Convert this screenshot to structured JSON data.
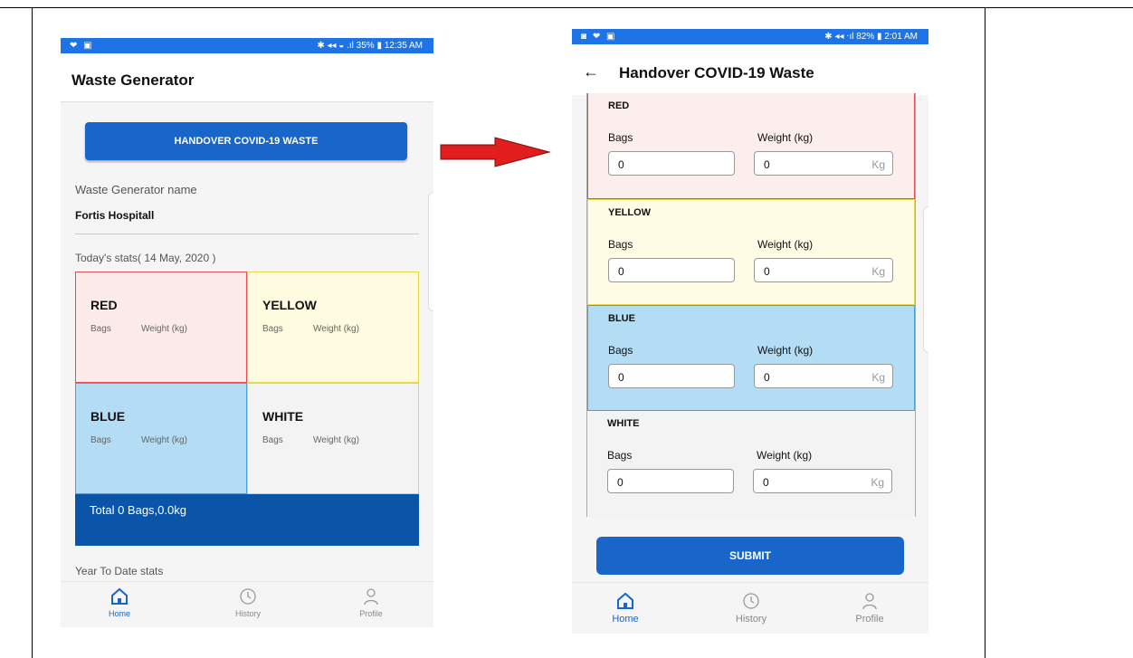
{
  "screen1": {
    "status_left": "❤ ▣",
    "status_right": "✱ ◂◂ ◒ .ıl 35% ▮ 12:35 AM",
    "title": "Waste Generator",
    "handover_button": "HANDOVER COVID-19 WASTE",
    "generator_label": "Waste Generator name",
    "generator_value": "Fortis Hospitall",
    "today_stats": "Today's stats( 14 May, 2020 )",
    "cells": [
      {
        "name": "RED",
        "bags": "Bags",
        "weight": "Weight (kg)"
      },
      {
        "name": "YELLOW",
        "bags": "Bags",
        "weight": "Weight (kg)"
      },
      {
        "name": "BLUE",
        "bags": "Bags",
        "weight": "Weight (kg)"
      },
      {
        "name": "WHITE",
        "bags": "Bags",
        "weight": "Weight (kg)"
      }
    ],
    "total": "Total 0 Bags,0.0kg",
    "ytd": "Year To Date stats",
    "nav": [
      "Home",
      "History",
      "Profile"
    ]
  },
  "screen2": {
    "status_left": "◙ ❤ ▣",
    "status_right": "✱ ◂◂ ‧ıl 82% ▮ 2:01 AM",
    "back": "←",
    "title": "Handover COVID-19 Waste",
    "bags_label": "Bags",
    "weight_label": "Weight (kg)",
    "unit": "Kg",
    "sections": [
      {
        "name": "RED",
        "bags_value": "0",
        "weight_value": "0"
      },
      {
        "name": "YELLOW",
        "bags_value": "0",
        "weight_value": "0"
      },
      {
        "name": "BLUE",
        "bags_value": "0",
        "weight_value": "0"
      },
      {
        "name": "WHITE",
        "bags_value": "0",
        "weight_value": "0"
      }
    ],
    "submit": "SUBMIT",
    "nav": [
      "Home",
      "History",
      "Profile"
    ]
  },
  "colors": {
    "primary": "#1866c9",
    "status_bar": "#1e74e6",
    "arrow": "#e11d1d",
    "red_bg": "#fdeaea",
    "yellow_bg": "#fefbe0",
    "blue_bg": "#b3dcf5",
    "white_bg": "#f3f3f3",
    "total_bg": "#0b55a8"
  },
  "icons": [
    "home-icon",
    "history-icon",
    "profile-icon",
    "back-arrow-icon",
    "right-arrow-icon"
  ]
}
